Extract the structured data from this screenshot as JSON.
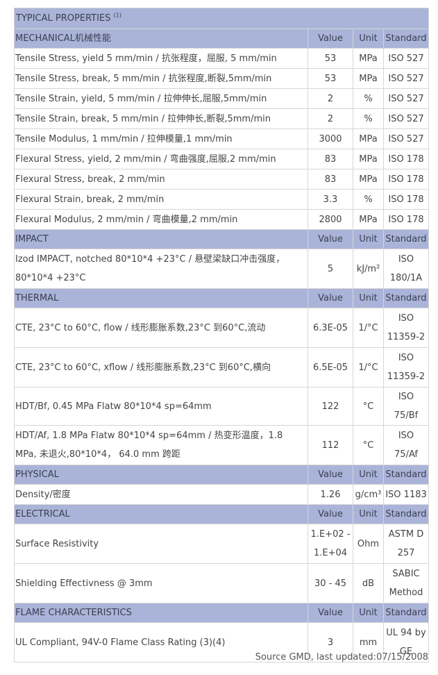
{
  "title": "TYPICAL PROPERTIES",
  "title_note": "(1)",
  "sections": [
    {
      "name": "MECHANICAL机械性能",
      "value_header": "Value",
      "unit_header": "Unit",
      "standard_header": "Standard",
      "rows": [
        {
          "param": "Tensile Stress, yield 5 mm/min / 抗张程度，屈服, 5 mm/min",
          "value": "53",
          "unit": "MPa",
          "standard": "ISO 527"
        },
        {
          "param": "Tensile Stress, break, 5 mm/min / 抗张程度,断裂,5mm/min",
          "value": "53",
          "unit": "MPa",
          "standard": "ISO 527"
        },
        {
          "param": "Tensile Strain, yield, 5 mm/min / 拉伸伸长,屈服,5mm/min",
          "value": "2",
          "unit": "%",
          "standard": "ISO 527"
        },
        {
          "param": "Tensile Strain, break, 5 mm/min / 拉伸伸长,断裂,5mm/min",
          "value": "2",
          "unit": "%",
          "standard": "ISO 527"
        },
        {
          "param": "Tensile Modulus, 1 mm/min / 拉伸模量,1 mm/min",
          "value": "3000",
          "unit": "MPa",
          "standard": "ISO 527"
        },
        {
          "param": "Flexural Stress, yield, 2 mm/min / 弯曲强度,屈服,2 mm/min",
          "value": "83",
          "unit": "MPa",
          "standard": "ISO 178"
        },
        {
          "param": "Flexural Stress, break, 2 mm/min",
          "value": "83",
          "unit": "MPa",
          "standard": "ISO 178"
        },
        {
          "param": "Flexural Strain, break, 2 mm/min",
          "value": "3.3",
          "unit": "%",
          "standard": "ISO 178"
        },
        {
          "param": "Flexural Modulus, 2 mm/min / 弯曲模量,2 mm/min",
          "value": "2800",
          "unit": "MPa",
          "standard": "ISO 178"
        }
      ]
    },
    {
      "name": "IMPACT",
      "value_header": "Value",
      "unit_header": "Unit",
      "standard_header": "Standard",
      "rows": [
        {
          "param": "Izod IMPACT, notched 80*10*4 +23°C / 悬壁梁缺口冲击强度，80*10*4 +23°C",
          "value": "5",
          "unit": "kJ/m²",
          "standard": "ISO 180/1A",
          "tall": true
        }
      ]
    },
    {
      "name": "THERMAL",
      "value_header": "Value",
      "unit_header": "Unit",
      "standard_header": "Standard",
      "rows": [
        {
          "param": "CTE, 23°C to 60°C, flow / 线形膨胀系数,23°C 到60°C,流动",
          "value": "6.3E-05",
          "unit": "1/°C",
          "standard": "ISO 11359-2",
          "tall": true
        },
        {
          "param": "CTE, 23°C to 60°C, xflow / 线形膨胀系数,23°C 到60°C,横向",
          "value": "6.5E-05",
          "unit": "1/°C",
          "standard": "ISO 11359-2",
          "tall": true
        },
        {
          "param": "HDT/Bf, 0.45 MPa Flatw 80*10*4 sp=64mm",
          "value": "122",
          "unit": "°C",
          "standard": "ISO 75/Bf"
        },
        {
          "param": "HDT/Af, 1.8 MPa Flatw 80*10*4 sp=64mm / 热变形温度，1.8 MPa, 未退火,80*10*4， 64.0 mm 跨距",
          "value": "112",
          "unit": "°C",
          "standard": "ISO 75/Af",
          "tall": true
        }
      ]
    },
    {
      "name": "PHYSICAL",
      "value_header": "Value",
      "unit_header": "Unit",
      "standard_header": "Standard",
      "rows": [
        {
          "param": "Density/密度",
          "value": "1.26",
          "unit": "g/cm³",
          "standard": "ISO 1183"
        }
      ]
    },
    {
      "name": "ELECTRICAL",
      "value_header": "Value",
      "unit_header": "Unit",
      "standard_header": "Standard",
      "rows": [
        {
          "param": "Surface Resistivity",
          "value": "1.E+02 - 1.E+04",
          "unit": "Ohm",
          "standard": "ASTM D 257",
          "tall": true
        },
        {
          "param": "Shielding Effectivness @ 3mm",
          "value": "30 - 45",
          "unit": "dB",
          "standard": "SABIC Method",
          "tall": true
        }
      ]
    },
    {
      "name": "FLAME CHARACTERISTICS",
      "value_header": "Value",
      "unit_header": "Unit",
      "standard_header": "Standard",
      "rows": [
        {
          "param": "UL Compliant, 94V-0 Flame Class Rating (3)(4)",
          "value": "3",
          "unit": "mm",
          "standard": "UL 94 by GE",
          "tall": true
        }
      ]
    }
  ],
  "source": "Source GMD, last updated:07/15/2008",
  "colors": {
    "header_bg": "#a9b4d8",
    "border": "#d6d6d6",
    "text": "#444444"
  }
}
